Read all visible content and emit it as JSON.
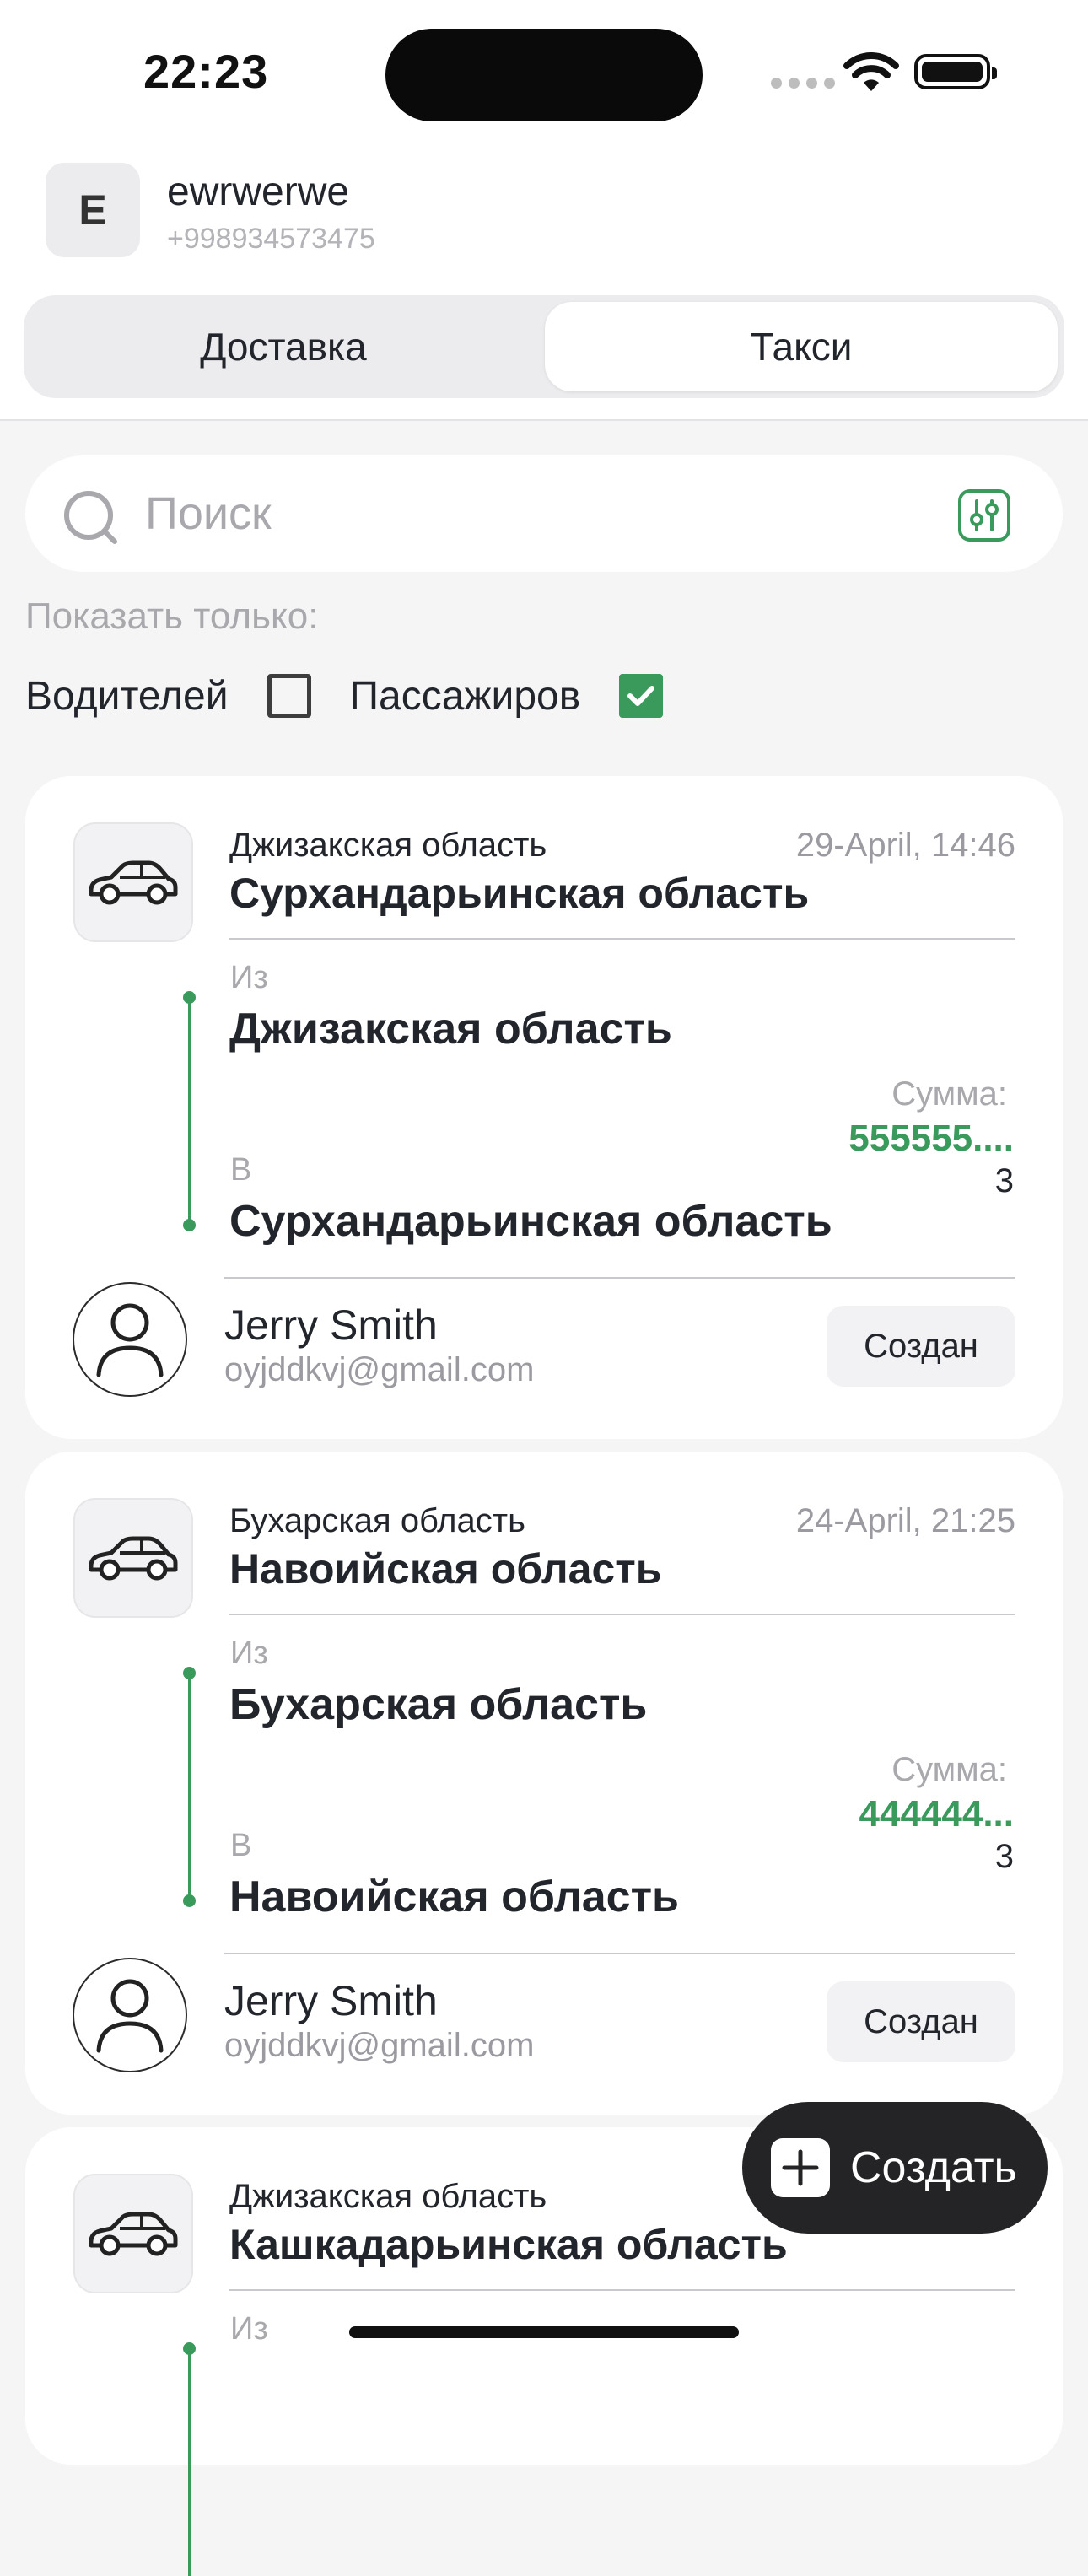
{
  "status_bar": {
    "time": "22:23"
  },
  "user": {
    "initial": "E",
    "name": "ewrwerwe",
    "phone": "+998934573475"
  },
  "tabs": [
    {
      "label": "Доставка",
      "selected": false
    },
    {
      "label": "Такси",
      "selected": true
    }
  ],
  "search": {
    "placeholder": "Поиск"
  },
  "filter": {
    "title": "Показать только:",
    "options": [
      {
        "label": "Водителей",
        "checked": false
      },
      {
        "label": "Пассажиров",
        "checked": true
      }
    ]
  },
  "orders": [
    {
      "region_small": "Джизакская область",
      "region_big": "Сурхандарьинская область",
      "date": "29-April, 14:46",
      "from_label": "Из",
      "from": "Джизакская область",
      "to_label": "В",
      "to": "Сурхандарьинская область",
      "sum_label": "Сумма:",
      "sum_value": "555555....",
      "count": "3",
      "person_name": "Jerry Smith",
      "person_email": "oyjddkvj@gmail.com",
      "status": "Создан"
    },
    {
      "region_small": "Бухарская область",
      "region_big": "Навоийская область",
      "date": "24-April, 21:25",
      "from_label": "Из",
      "from": "Бухарская область",
      "to_label": "В",
      "to": "Навоийская область",
      "sum_label": "Сумма:",
      "sum_value": "444444...",
      "count": "3",
      "person_name": "Jerry Smith",
      "person_email": "oyjddkvj@gmail.com",
      "status": "Создан"
    },
    {
      "region_small": "Джизакская область",
      "region_big": "Кашкадарьинская область",
      "from_label": "Из"
    }
  ],
  "create_button": {
    "label": "Создать"
  },
  "colors": {
    "accent": "#3a9a5c",
    "background": "#f5f5f6",
    "fab": "#242426"
  }
}
